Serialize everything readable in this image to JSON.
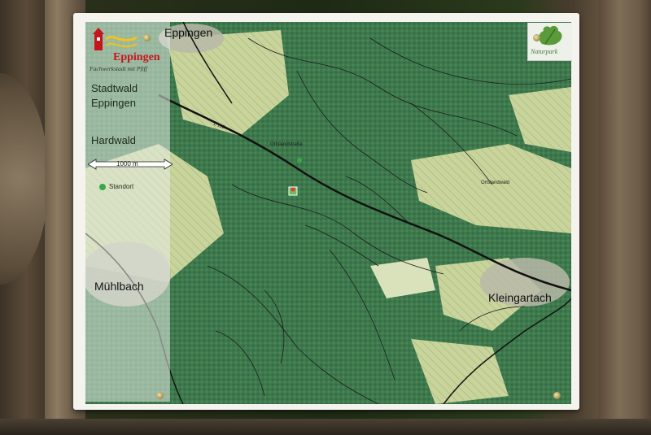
{
  "logo": {
    "name": "Eppingen",
    "subtitle": "Fachwerkstadt mit Pfiff"
  },
  "sidebar": {
    "title_line1": "Stadtwald",
    "title_line2": "Eppingen",
    "area_label": "Hardwald",
    "scale_label": "1000 m",
    "legend_label": "Standort"
  },
  "towns": {
    "top": "Eppingen",
    "left": "Mühlbach",
    "right": "Kleingartach"
  },
  "map_labels": {
    "road_l118": "L 118",
    "place_small_1": "Ortslandwald",
    "place_small_2": "Ortslandstraße"
  },
  "partner": {
    "name": "Naturpark"
  },
  "colors": {
    "forest": "#3f7a4c",
    "field": "#c9d4a0",
    "road": "#111111",
    "logo_red": "#c5161d",
    "standort": "#3aa84a"
  }
}
